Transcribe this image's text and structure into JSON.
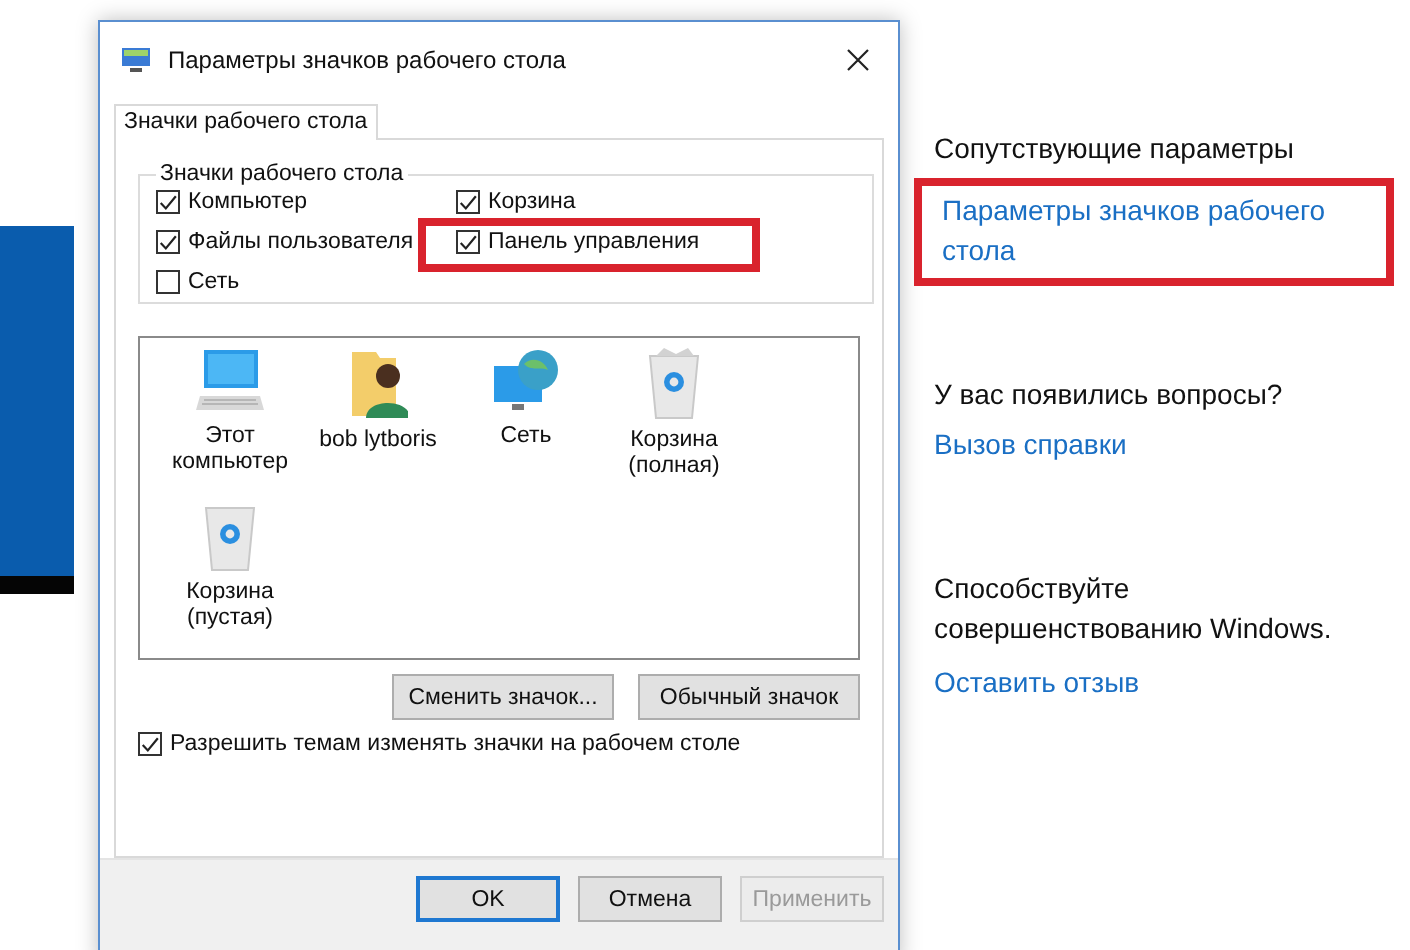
{
  "dialog": {
    "title": "Параметры значков рабочего стола",
    "tabs": [
      {
        "label": "Значки рабочего стола",
        "selected": true
      }
    ],
    "group": {
      "title": "Значки рабочего стола",
      "checkboxes": [
        {
          "label": "Компьютер",
          "checked": true,
          "highlighted": false
        },
        {
          "label": "Корзина",
          "checked": true,
          "highlighted": false
        },
        {
          "label": "Файлы пользователя",
          "checked": true,
          "highlighted": false
        },
        {
          "label": "Панель управления",
          "checked": true,
          "highlighted": true
        },
        {
          "label": "Сеть",
          "checked": false,
          "highlighted": false
        }
      ]
    },
    "icons": [
      {
        "label": "Этот компьютер",
        "kind": "computer"
      },
      {
        "label": "bob lytboris",
        "kind": "user"
      },
      {
        "label": "Сеть",
        "kind": "network"
      },
      {
        "label": "Корзина (полная)",
        "kind": "bin-full"
      },
      {
        "label": "Корзина (пустая)",
        "kind": "bin-empty"
      }
    ],
    "icon_buttons": [
      "Сменить значок...",
      "Обычный значок"
    ],
    "theme_checkbox": {
      "label": "Разрешить темам изменять значки на рабочем столе",
      "checked": true
    },
    "buttons": [
      {
        "label": "OK",
        "default": true,
        "disabled": false
      },
      {
        "label": "Отмена",
        "default": false,
        "disabled": false
      },
      {
        "label": "Применить",
        "default": false,
        "disabled": true
      }
    ]
  },
  "related": {
    "heading": "Сопутствующие параметры",
    "link": {
      "label": "Параметры значков рабочего стола",
      "highlighted": true
    }
  },
  "questions": {
    "heading": "У вас появились вопросы?",
    "link": "Вызов справки"
  },
  "feedback": {
    "heading": "Способствуйте совершенствованию Windows.",
    "link": "Оставить отзыв"
  }
}
